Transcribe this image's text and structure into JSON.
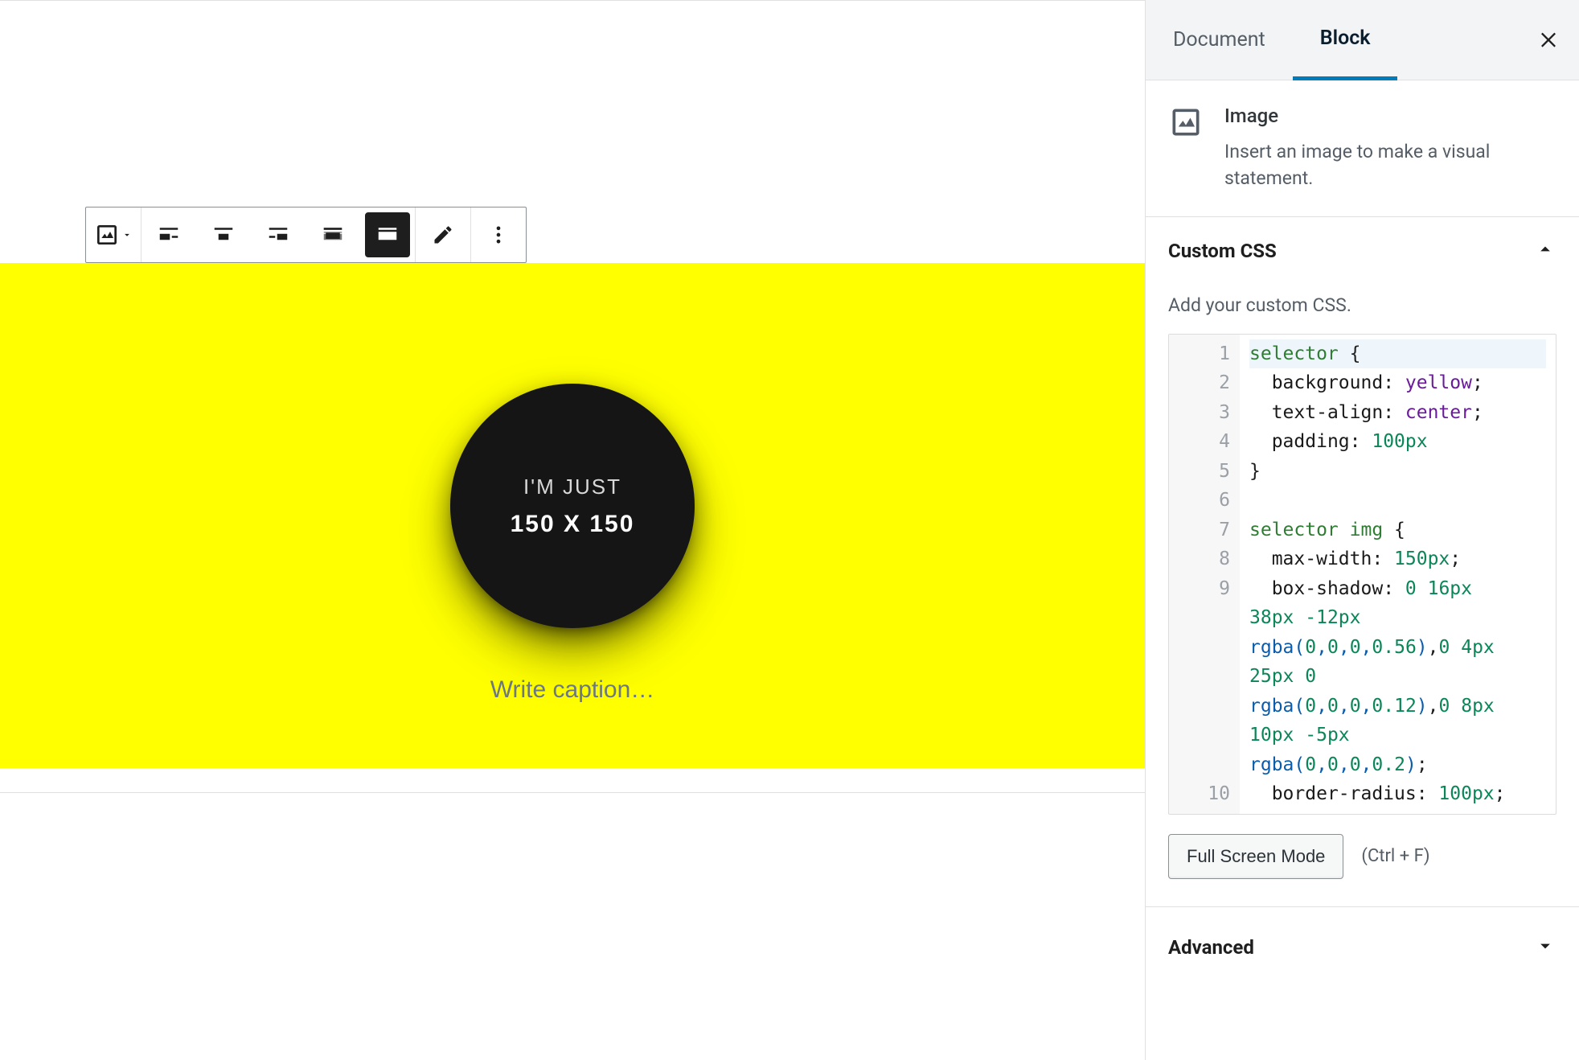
{
  "toolbar": {
    "block_type": "image",
    "align_options": [
      "align-left",
      "align-center",
      "align-right",
      "align-wide",
      "align-full"
    ],
    "active_align": "align-full",
    "edit_label": "Edit"
  },
  "image_placeholder": {
    "line1": "I'M JUST",
    "line2": "150 X 150",
    "caption_placeholder": "Write caption…"
  },
  "sidebar": {
    "tabs": {
      "document": "Document",
      "block": "Block",
      "active": "block"
    },
    "block_info": {
      "title": "Image",
      "description": "Insert an image to make a visual statement."
    },
    "css_panel": {
      "title": "Custom CSS",
      "hint": "Add your custom CSS.",
      "expanded": true,
      "code_lines": [
        "selector {",
        "  background: yellow;",
        "  text-align: center;",
        "  padding: 100px",
        "}",
        "",
        "selector img {",
        "  max-width: 150px;",
        "  box-shadow: 0 16px",
        "38px -12px",
        "rgba(0,0,0,0.56),0 4px",
        "25px 0",
        "rgba(0,0,0,0.12),0 8px",
        "10px -5px",
        "rgba(0,0,0,0.2);",
        "  border-radius: 100px;"
      ],
      "line_numbers": [
        "1",
        "2",
        "3",
        "4",
        "5",
        "6",
        "7",
        "8",
        "9",
        "",
        "",
        "",
        "",
        "",
        "",
        "10"
      ],
      "fullscreen_label": "Full Screen Mode",
      "fullscreen_shortcut": "(Ctrl + F)"
    },
    "advanced_panel": {
      "title": "Advanced",
      "expanded": false
    }
  }
}
